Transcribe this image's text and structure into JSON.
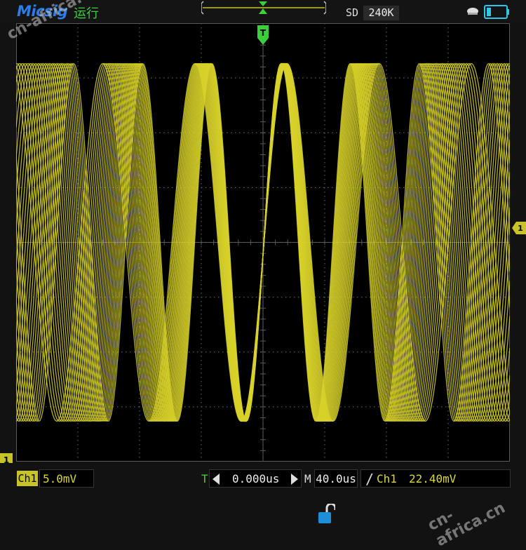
{
  "header": {
    "brand": "Micsig",
    "run_status": "运行",
    "mode_label": "SD",
    "memory_depth": "240K"
  },
  "channel": {
    "tag": "Ch1",
    "scale": "5.0mV",
    "marker": "1",
    "color": "#c8c326"
  },
  "timebase": {
    "delay_label": "T",
    "delay_value": "0.000us",
    "scale_label": "M",
    "scale_value": "40.0us"
  },
  "trigger": {
    "slope_symbol": "/",
    "source": "Ch1",
    "level": "22.40mV",
    "level_marker": "1",
    "position_marker": "T"
  },
  "watermark": {
    "top_left": "cn-africa.cn",
    "bottom_right": "cn-africa.cn"
  },
  "icons": {
    "battery": "battery-icon",
    "usb": "usb-icon",
    "lock": "unlock-icon"
  },
  "colors": {
    "trace": "#d8d22a",
    "grid": "#5a5a5a",
    "trigger_green": "#3ccf3c",
    "brand_blue": "#2b7de9"
  }
}
